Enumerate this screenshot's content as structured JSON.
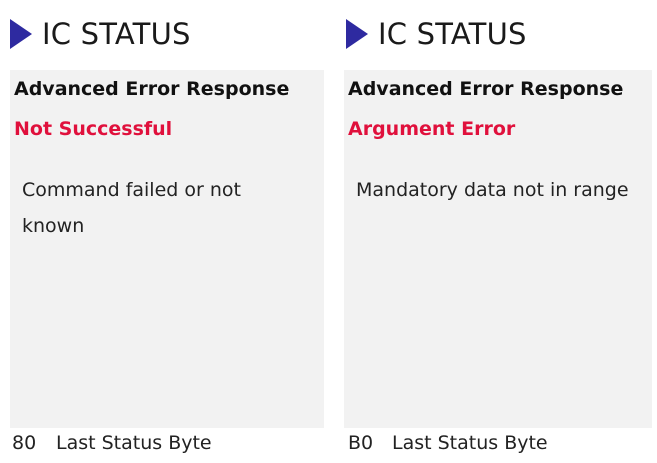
{
  "panels": [
    {
      "header": "IC STATUS",
      "title": "Advanced Error Response",
      "status": "Not Successful",
      "description": "Command failed or not known",
      "status_byte_value": "80",
      "status_byte_label": "Last Status Byte"
    },
    {
      "header": "IC STATUS",
      "title": "Advanced Error Response",
      "status": "Argument Error",
      "description": "Mandatory data not in range",
      "status_byte_value": "B0",
      "status_byte_label": "Last Status Byte"
    }
  ],
  "colors": {
    "accent": "#2e2aa0",
    "error": "#e0103c",
    "card_bg": "#f2f2f2"
  }
}
